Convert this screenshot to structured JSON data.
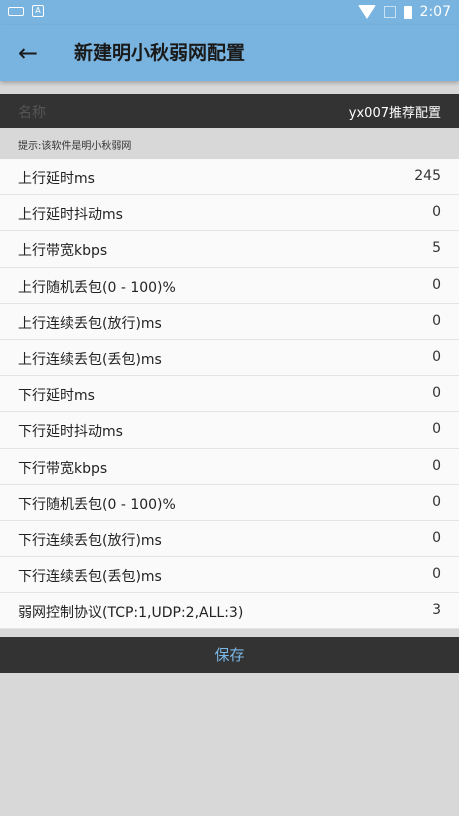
{
  "status_bar": {
    "time": "2:07",
    "notif_icon": "A"
  },
  "app_bar": {
    "title": "新建明小秋弱网配置"
  },
  "config": {
    "name_label": "名称",
    "name_value": "yx007推荐配置"
  },
  "hint": "提示:该软件是明小秋弱网",
  "rows": [
    {
      "label": "上行延时ms",
      "value": "245"
    },
    {
      "label": "上行延时抖动ms",
      "value": "0"
    },
    {
      "label": "上行带宽kbps",
      "value": "5"
    },
    {
      "label": "上行随机丢包(0 - 100)%",
      "value": "0"
    },
    {
      "label": "上行连续丢包(放行)ms",
      "value": "0"
    },
    {
      "label": "上行连续丢包(丢包)ms",
      "value": "0"
    },
    {
      "label": "下行延时ms",
      "value": "0"
    },
    {
      "label": "下行延时抖动ms",
      "value": "0"
    },
    {
      "label": "下行带宽kbps",
      "value": "0"
    },
    {
      "label": "下行随机丢包(0 - 100)%",
      "value": "0"
    },
    {
      "label": "下行连续丢包(放行)ms",
      "value": "0"
    },
    {
      "label": "下行连续丢包(丢包)ms",
      "value": "0"
    },
    {
      "label": "弱网控制协议(TCP:1,UDP:2,ALL:3)",
      "value": "3"
    }
  ],
  "save_label": "保存",
  "colors": {
    "app_bar": "#78b4df",
    "dark_bar": "#333333",
    "save_text": "#7ab8e8"
  }
}
